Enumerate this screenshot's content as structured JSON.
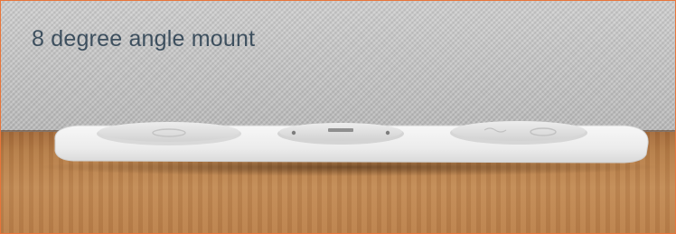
{
  "caption": "8 degree angle mount",
  "colors": {
    "frame_border": "#e8753a",
    "caption_text": "#3d4f5e"
  },
  "product": {
    "modules": [
      {
        "name": "power-socket-module"
      },
      {
        "name": "usb-charger-module"
      },
      {
        "name": "wireless-charger-module"
      }
    ]
  }
}
